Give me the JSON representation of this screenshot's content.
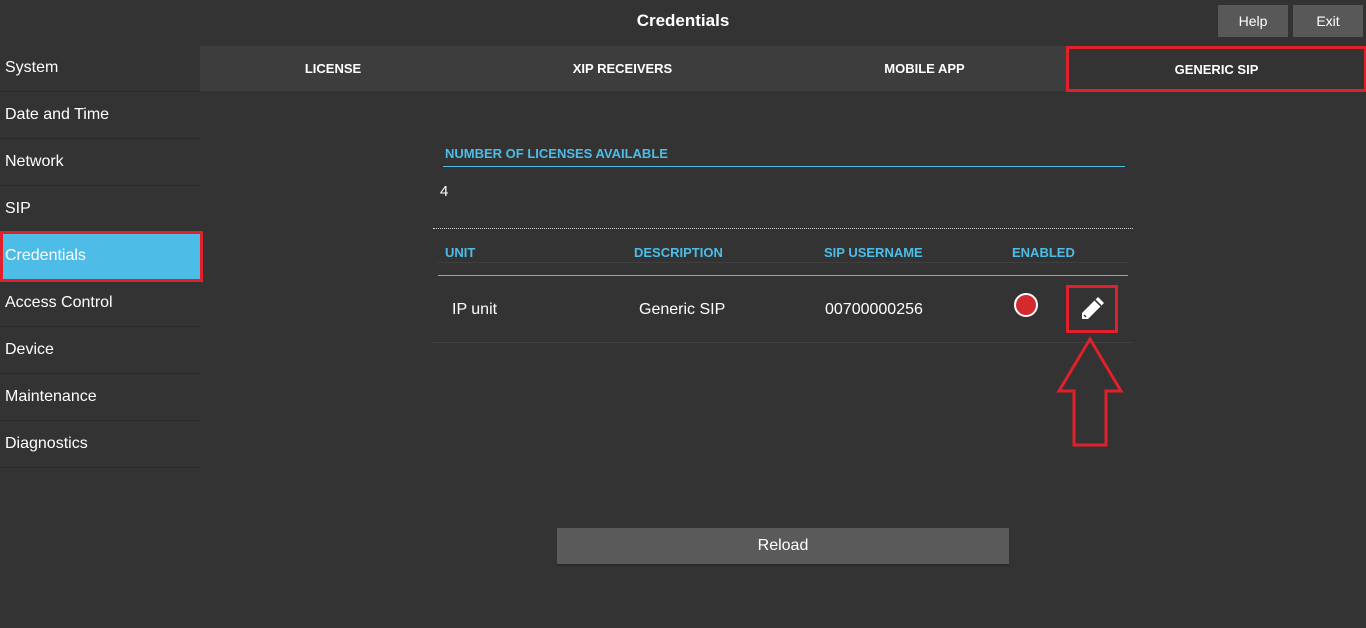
{
  "header": {
    "title": "Credentials",
    "help_label": "Help",
    "exit_label": "Exit"
  },
  "sidebar": {
    "items": [
      {
        "label": "System"
      },
      {
        "label": "Date and Time"
      },
      {
        "label": "Network"
      },
      {
        "label": "SIP"
      },
      {
        "label": "Credentials",
        "active": true
      },
      {
        "label": "Access Control"
      },
      {
        "label": "Device"
      },
      {
        "label": "Maintenance"
      },
      {
        "label": "Diagnostics"
      }
    ]
  },
  "tabs": [
    {
      "label": "LICENSE"
    },
    {
      "label": "XIP RECEIVERS"
    },
    {
      "label": "MOBILE APP"
    },
    {
      "label": "GENERIC SIP",
      "active": true
    }
  ],
  "licenses": {
    "label": "NUMBER OF LICENSES AVAILABLE",
    "value": "4"
  },
  "table": {
    "columns": [
      "UNIT",
      "DESCRIPTION",
      "SIP USERNAME",
      "ENABLED"
    ],
    "rows": [
      {
        "unit": "IP unit",
        "description": "Generic SIP",
        "sip_username": "00700000256",
        "enabled": false
      }
    ]
  },
  "reload_label": "Reload",
  "colors": {
    "accent": "#4dbde8",
    "highlight": "#e0202a",
    "status_disabled": "#d42a2f",
    "background": "#333333"
  },
  "icons": {
    "edit": "pencil-icon",
    "status": "status-dot",
    "annotation": "up-arrow-annotation"
  }
}
